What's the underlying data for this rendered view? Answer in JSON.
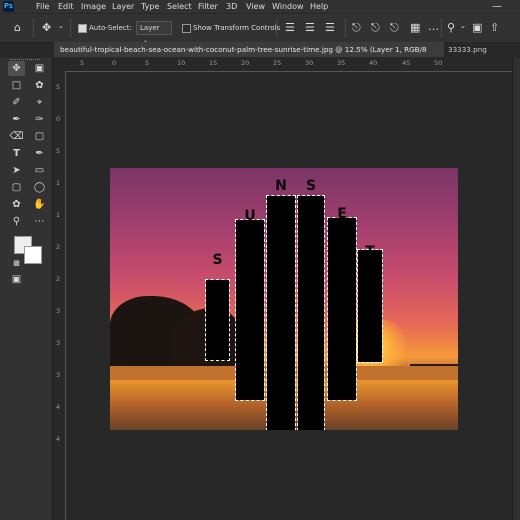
{
  "app": {
    "logo": "Ps"
  },
  "menu": [
    "File",
    "Edit",
    "Image",
    "Layer",
    "Type",
    "Select",
    "Filter",
    "3D",
    "View",
    "Window",
    "Help"
  ],
  "options": {
    "auto_select_label": "Auto-Select:",
    "auto_select_value": "Layer",
    "show_transform_label": "Show Transform Controls"
  },
  "tabs": [
    {
      "label": "beautiful-tropical-beach-sea-ocean-with-coconut-palm-tree-sunrise-time.jpg @ 12.5% (Layer 1, RGB/8",
      "active": true
    },
    {
      "label": "33333.png",
      "active": false
    }
  ],
  "ruler_top": [
    "5",
    "0",
    "5",
    "10",
    "15",
    "20",
    "25",
    "30",
    "35",
    "40",
    "45",
    "50"
  ],
  "ruler_left": [
    "5",
    "0",
    "5",
    "1",
    "1",
    "2",
    "2",
    "3",
    "3",
    "3",
    "4",
    "4"
  ],
  "artwork": {
    "letters": [
      "S",
      "U",
      "N",
      "S",
      "E",
      "T"
    ]
  },
  "colors": {
    "accent": "#31a8ff",
    "panel": "#323232",
    "canvas": "#282828"
  }
}
